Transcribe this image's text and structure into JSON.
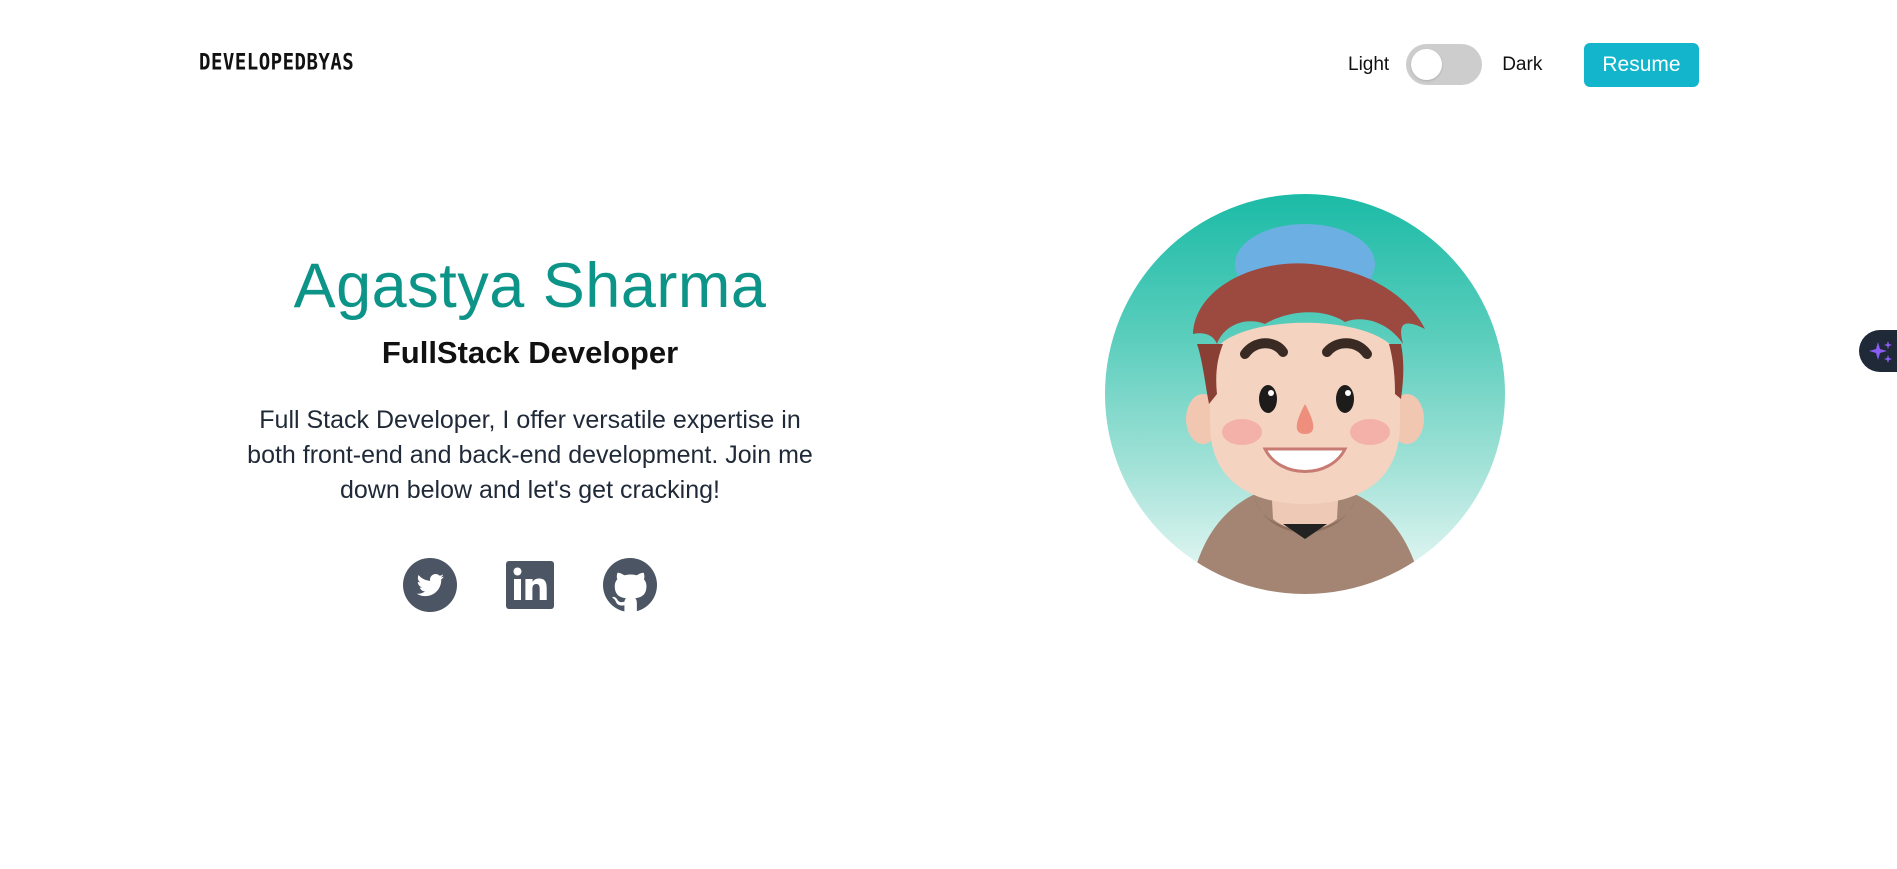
{
  "header": {
    "logo_text": "DEVELOPEDBYAS",
    "theme": {
      "light_label": "Light",
      "dark_label": "Dark",
      "is_dark": false
    },
    "resume_label": "Resume"
  },
  "hero": {
    "name": "Agastya Sharma",
    "role": "FullStack Developer",
    "description": "Full Stack Developer, I offer versatile expertise in both front-end and back-end development. Join me down below and let's get cracking!",
    "socials": [
      {
        "name": "Twitter",
        "icon": "twitter-icon"
      },
      {
        "name": "LinkedIn",
        "icon": "linkedin-icon"
      },
      {
        "name": "GitHub",
        "icon": "github-icon"
      }
    ],
    "avatar_icon": "3d-avatar-illustration"
  },
  "floating": {
    "icon": "sparkles-icon"
  },
  "colors": {
    "accent": "#0d9488",
    "button": "#12b5cc",
    "icon": "#4b5563",
    "toggle_track": "#cdcdcd",
    "floating_tab": "#1f2937",
    "sparkle": "#8b5cf6"
  }
}
